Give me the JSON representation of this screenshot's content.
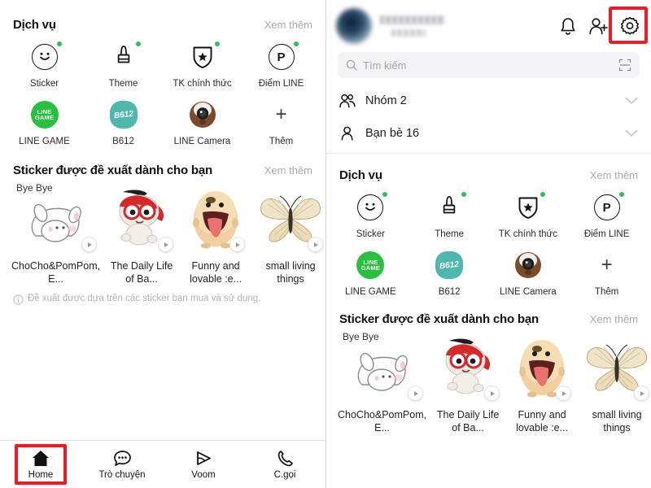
{
  "app": {
    "name": "LINE",
    "accent_green": "#2ebd59",
    "highlight_red": "#ed1c24"
  },
  "left_panel": {
    "services": {
      "title": "Dịch vụ",
      "more_label": "Xem thêm",
      "items": [
        {
          "label": "Sticker",
          "icon": "smiley-icon",
          "badge": true
        },
        {
          "label": "Theme",
          "icon": "brush-icon",
          "badge": true
        },
        {
          "label": "TK chính thức",
          "icon": "shield-star-icon",
          "badge": true
        },
        {
          "label": "Điểm LINE",
          "icon": "point-p-icon",
          "badge": true
        },
        {
          "label": "LINE GAME",
          "icon": "line-game-icon",
          "badge": false,
          "glyph": "LINE GAME",
          "color": "#27c13f"
        },
        {
          "label": "B612",
          "icon": "b612-icon",
          "badge": false,
          "glyph": "B612",
          "color": "#4fb8ae"
        },
        {
          "label": "LINE Camera",
          "icon": "line-camera-icon",
          "badge": false
        },
        {
          "label": "Thêm",
          "icon": "plus-icon",
          "badge": false,
          "glyph": "+"
        }
      ]
    },
    "stickers": {
      "title": "Sticker được đề xuất dành cho bạn",
      "more_label": "Xem thêm",
      "items": [
        {
          "name": "ChoCho&PomPom, E...",
          "caption": "Bye Bye",
          "art": "rabbit"
        },
        {
          "name": "The Daily Life of Ba...",
          "caption": "",
          "art": "superhero"
        },
        {
          "name": "Funny and lovable :e...",
          "caption": "",
          "art": "egg"
        },
        {
          "name": "small living things",
          "caption": "",
          "art": "butterfly"
        }
      ]
    },
    "note": "Đề xuất được dựa trên các sticker bạn mua và sử dụng.",
    "bottom_nav": {
      "items": [
        {
          "label": "Home",
          "icon": "home-icon",
          "active": true
        },
        {
          "label": "Trò chuyện",
          "icon": "chat-bubble-icon",
          "active": false
        },
        {
          "label": "Voom",
          "icon": "voom-play-icon",
          "active": false
        },
        {
          "label": "C.gọi",
          "icon": "phone-icon",
          "active": false
        }
      ]
    }
  },
  "right_panel": {
    "header": {
      "profile_name_hidden": "",
      "profile_status_hidden": "",
      "actions": [
        {
          "name": "notification-bell-icon",
          "label": ""
        },
        {
          "name": "add-friend-icon",
          "label": ""
        },
        {
          "name": "gear-icon",
          "label": "",
          "highlighted": true
        }
      ]
    },
    "search": {
      "placeholder": "Tìm kiếm",
      "scan_icon": "qr-scan-icon"
    },
    "lists": [
      {
        "label": "Nhóm 2",
        "icon": "group-icon"
      },
      {
        "label": "Bạn bè 16",
        "icon": "person-icon"
      }
    ],
    "services": {
      "title": "Dịch vụ",
      "more_label": "Xem thêm",
      "items": [
        {
          "label": "Sticker",
          "icon": "smiley-icon",
          "badge": true
        },
        {
          "label": "Theme",
          "icon": "brush-icon",
          "badge": true
        },
        {
          "label": "TK chính thức",
          "icon": "shield-star-icon",
          "badge": true
        },
        {
          "label": "Điểm LINE",
          "icon": "point-p-icon",
          "badge": true
        },
        {
          "label": "LINE GAME",
          "icon": "line-game-icon",
          "badge": false,
          "glyph": "LINE GAME",
          "color": "#27c13f"
        },
        {
          "label": "B612",
          "icon": "b612-icon",
          "badge": false,
          "glyph": "B612",
          "color": "#4fb8ae"
        },
        {
          "label": "LINE Camera",
          "icon": "line-camera-icon",
          "badge": false
        },
        {
          "label": "Thêm",
          "icon": "plus-icon",
          "badge": false,
          "glyph": "+"
        }
      ]
    },
    "stickers": {
      "title": "Sticker được đề xuất dành cho bạn",
      "more_label": "Xem thêm",
      "items": [
        {
          "name": "ChoCho&PomPom, E...",
          "caption": "Bye Bye",
          "art": "rabbit"
        },
        {
          "name": "The Daily Life of Ba...",
          "caption": "",
          "art": "superhero"
        },
        {
          "name": "Funny and lovable :e...",
          "caption": "",
          "art": "egg"
        },
        {
          "name": "small living things",
          "caption": "",
          "art": "butterfly"
        }
      ]
    }
  }
}
